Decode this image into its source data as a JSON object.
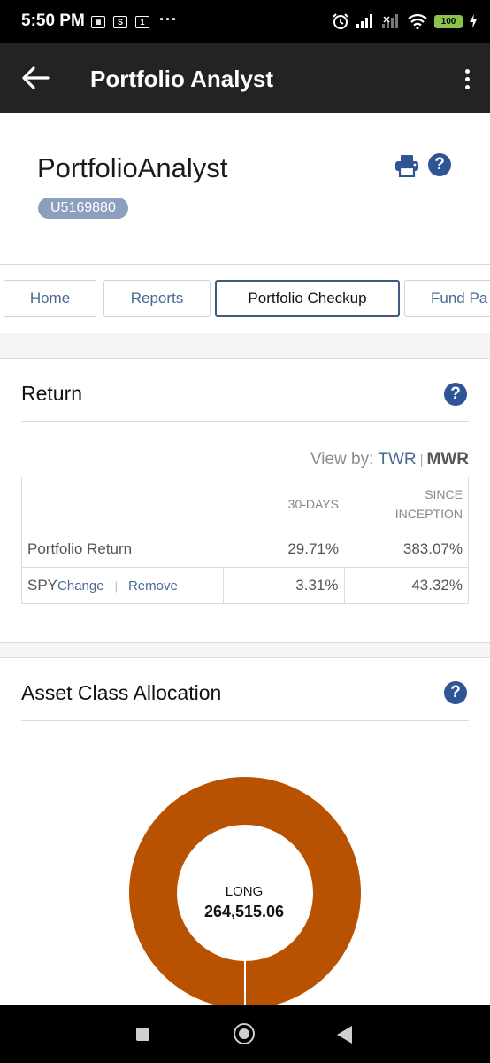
{
  "status_bar": {
    "time": "5:50 PM",
    "notif_s": "S",
    "notif_1": "1",
    "more_dots": "···",
    "battery": "100"
  },
  "app_bar": {
    "title": "Portfolio Analyst"
  },
  "header": {
    "title": "PortfolioAnalyst",
    "account_id": "U5169880"
  },
  "tabs": [
    {
      "label": "Home",
      "active": false
    },
    {
      "label": "Reports",
      "active": false
    },
    {
      "label": "Portfolio Checkup",
      "active": true
    },
    {
      "label": "Fund Pa",
      "active": false
    }
  ],
  "return_card": {
    "title": "Return",
    "view_by_label": "View by:",
    "view_by_twr": "TWR",
    "view_by_sep": "|",
    "view_by_mwr": "MWR",
    "columns": {
      "col1": "30-DAYS",
      "col2_line1": "SINCE",
      "col2_line2": "INCEPTION"
    },
    "rows": [
      {
        "label": "Portfolio Return",
        "thirty_days": "29.71%",
        "since_inception": "383.07%"
      }
    ],
    "benchmark": {
      "symbol": "SPY",
      "change_link": "Change",
      "separator": "|",
      "remove_link": "Remove",
      "thirty_days": "3.31%",
      "since_inception": "43.32%"
    }
  },
  "asset_card": {
    "title": "Asset Class Allocation",
    "donut_label": "LONG",
    "donut_value": "264,515.06",
    "donut_share": 1.0
  },
  "colors": {
    "app_bar": "#222324",
    "accent_blue": "#2f5597",
    "link_blue": "#4a6894",
    "donut_fill": "#b85200",
    "badge_bg": "#8c9fbd"
  }
}
